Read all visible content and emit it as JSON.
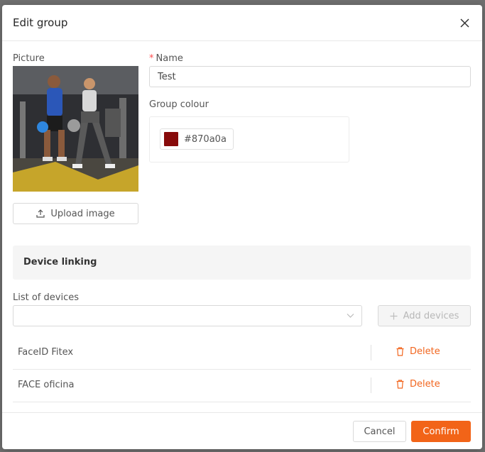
{
  "dialog": {
    "title": "Edit group"
  },
  "picture": {
    "label": "Picture",
    "upload_label": "Upload image"
  },
  "name_field": {
    "required_mark": "*",
    "label": "Name",
    "value": "Test"
  },
  "group_colour": {
    "label": "Group colour",
    "value": "#870a0a"
  },
  "device_linking": {
    "section_title": "Device linking",
    "list_label": "List of devices",
    "select_value": "",
    "add_devices_label": "Add devices",
    "devices": [
      {
        "name": "FaceID Fitex",
        "delete_label": "Delete"
      },
      {
        "name": "FACE oficina",
        "delete_label": "Delete"
      }
    ]
  },
  "footer": {
    "cancel_label": "Cancel",
    "confirm_label": "Confirm"
  },
  "colors": {
    "accent": "#f26418",
    "swatch": "#870a0a"
  }
}
